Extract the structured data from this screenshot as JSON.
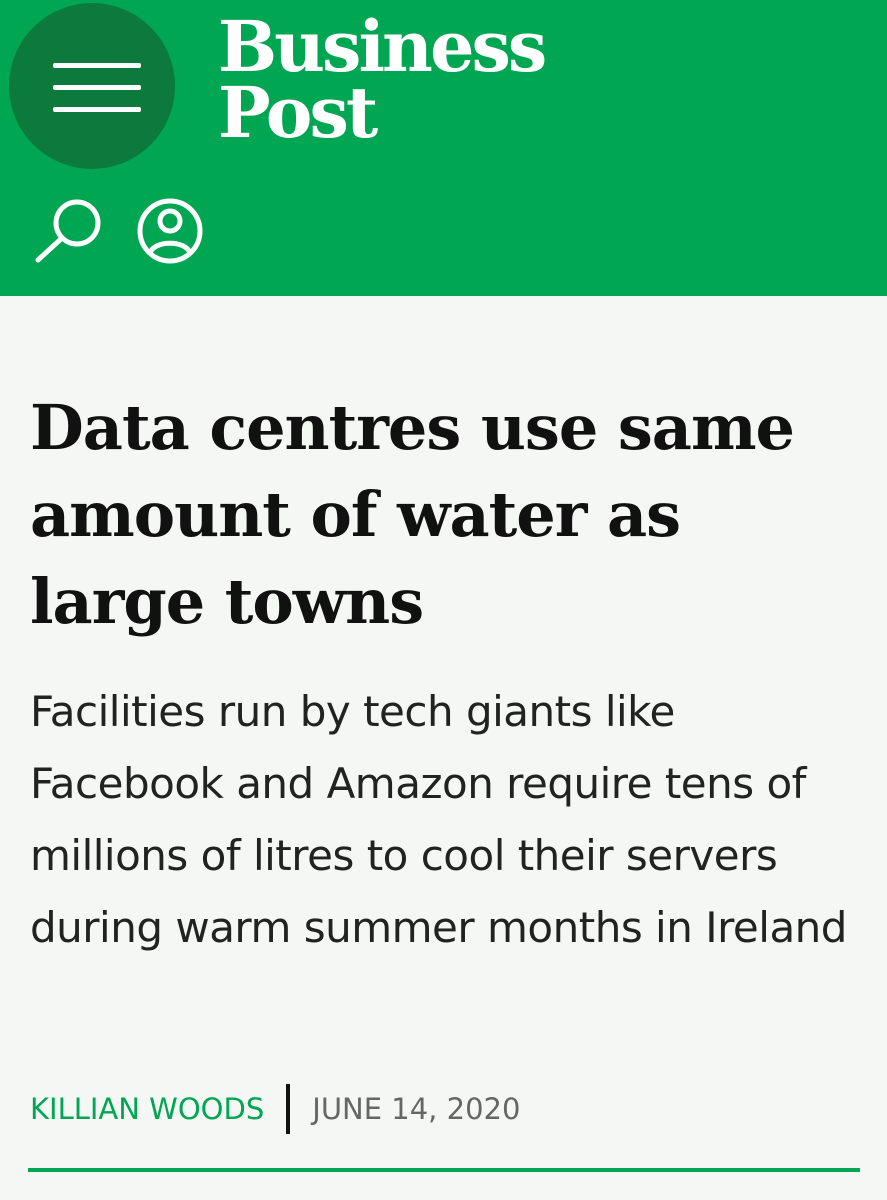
{
  "colors": {
    "brand_green": "#00a651",
    "menu_dark_green": "#0b7a3c",
    "background": "#f5f7f5",
    "headline_text": "#111111",
    "date_text": "#666666"
  },
  "header": {
    "logo_line1": "Business",
    "logo_line2": "Post",
    "menu_icon": "hamburger-menu-icon",
    "search_icon": "search-icon",
    "account_icon": "user-account-icon"
  },
  "article": {
    "headline": "Data centres use same amount of water as large towns",
    "standfirst": "Facilities run by tech giants like Facebook and Amazon require tens of millions of litres to cool their servers during warm summer months in Ireland",
    "author": "KILLIAN WOODS",
    "date": "JUNE 14, 2020"
  }
}
